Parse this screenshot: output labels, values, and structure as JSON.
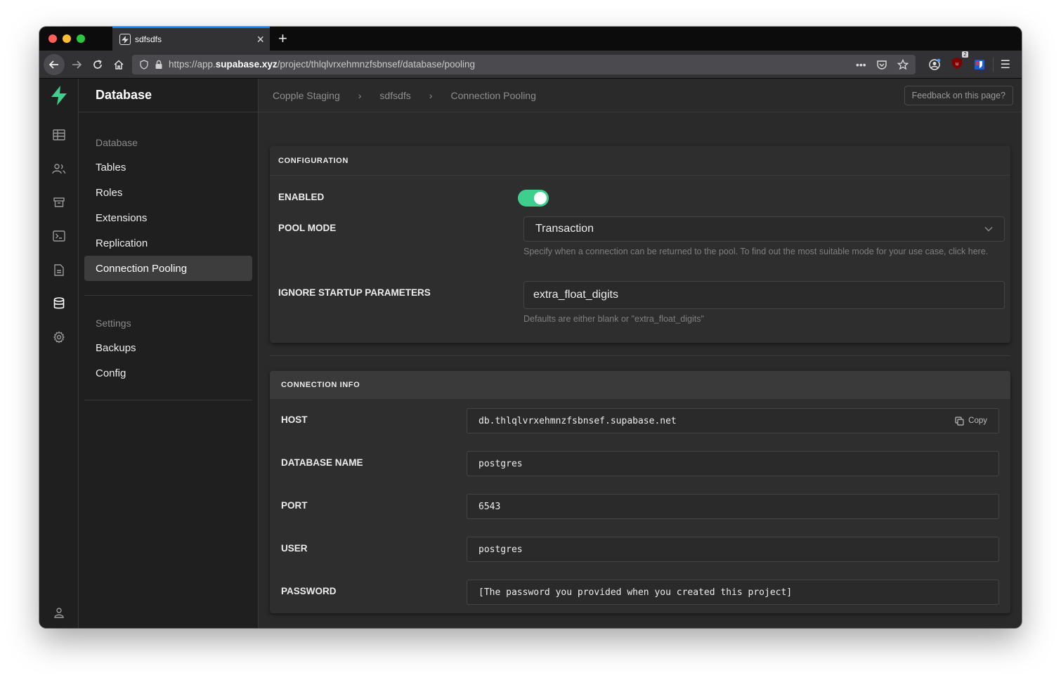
{
  "browser": {
    "tab_title": "sdfsdfs",
    "url_prefix": "https://app.",
    "url_domain": "supabase.xyz",
    "url_path": "/project/thlqlvrxehmnzfsbnsef/database/pooling",
    "ext_badge_count": "2",
    "new_tab_symbol": "+",
    "close_symbol": "×"
  },
  "sidebar": {
    "title": "Database",
    "section_database": "Database",
    "items": [
      {
        "label": "Tables"
      },
      {
        "label": "Roles"
      },
      {
        "label": "Extensions"
      },
      {
        "label": "Replication"
      },
      {
        "label": "Connection Pooling"
      }
    ],
    "section_settings": "Settings",
    "settings_items": [
      {
        "label": "Backups"
      },
      {
        "label": "Config"
      }
    ]
  },
  "breadcrumb": {
    "items": [
      "Copple Staging",
      "sdfsdfs",
      "Connection Pooling"
    ]
  },
  "feedback_label": "Feedback on this page?",
  "configuration": {
    "heading": "CONFIGURATION",
    "enabled_label": "ENABLED",
    "enabled": true,
    "pool_mode_label": "POOL MODE",
    "pool_mode_value": "Transaction",
    "pool_mode_help": "Specify when a connection can be returned to the pool. To find out the most suitable mode for your use case, click here.",
    "ignore_label": "IGNORE STARTUP PARAMETERS",
    "ignore_value": "extra_float_digits",
    "ignore_help": "Defaults are either blank or \"extra_float_digits\""
  },
  "connection_info": {
    "heading": "CONNECTION INFO",
    "copy_label": "Copy",
    "fields": [
      {
        "label": "HOST",
        "value": "db.thlqlvrxehmnzfsbnsef.supabase.net"
      },
      {
        "label": "DATABASE NAME",
        "value": "postgres"
      },
      {
        "label": "PORT",
        "value": "6543"
      },
      {
        "label": "USER",
        "value": "postgres"
      },
      {
        "label": "PASSWORD",
        "value": "[The password you provided when you created this project]"
      }
    ]
  },
  "colors": {
    "accent": "#3ecf8e",
    "background": "#2a2a2a",
    "sidebar": "#1f1f1f"
  }
}
